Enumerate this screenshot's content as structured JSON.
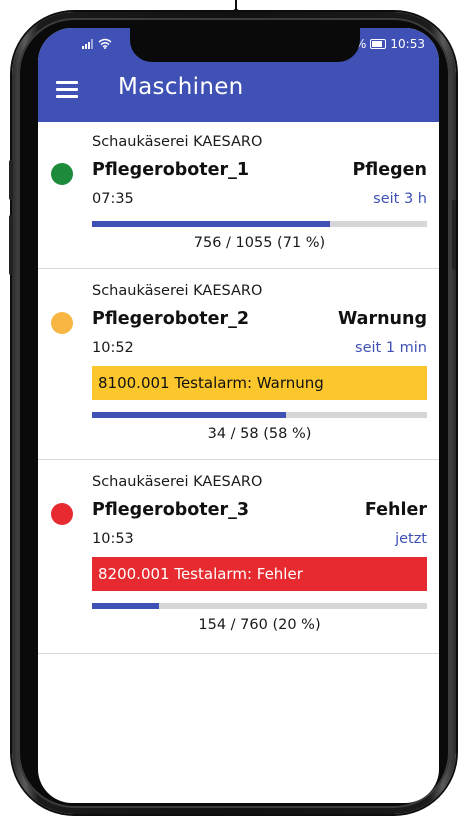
{
  "status": {
    "signal_icon": "signal-icon",
    "wifi_icon": "wifi-icon",
    "battery_icon": "battery-icon",
    "battery_prefix": "%",
    "time": "10:53"
  },
  "appbar": {
    "menu_icon": "hamburger-menu-icon",
    "title": "Maschinen"
  },
  "colors": {
    "primary": "#3f51b5",
    "status_ok": "#1e8a3c",
    "status_warning": "#f7b541",
    "status_error": "#e62a2f",
    "alarm_warning_bg": "#fcc72c",
    "alarm_error_bg": "#e62a2f"
  },
  "machines": [
    {
      "site": "Schaukäserei KAESARO",
      "name": "Pflegeroboter_1",
      "state": "Pflegen",
      "status_color": "#1e8a3c",
      "time": "07:35",
      "since": "seit 3 h",
      "alarm": null,
      "progress": 0.71,
      "progress_label": "756 / 1055  (71 %)"
    },
    {
      "site": "Schaukäserei KAESARO",
      "name": "Pflegeroboter_2",
      "state": "Warnung",
      "status_color": "#f7b541",
      "time": "10:52",
      "since": "seit 1 min",
      "alarm": "8100.001 Testalarm: Warnung",
      "progress": 0.58,
      "progress_label": "34 / 58  (58 %)"
    },
    {
      "site": "Schaukäserei KAESARO",
      "name": "Pflegeroboter_3",
      "state": "Fehler",
      "status_color": "#e62a2f",
      "time": "10:53",
      "since": "jetzt",
      "alarm": "8200.001 Testalarm: Fehler",
      "progress": 0.2,
      "progress_label": "154 / 760  (20 %)"
    }
  ]
}
